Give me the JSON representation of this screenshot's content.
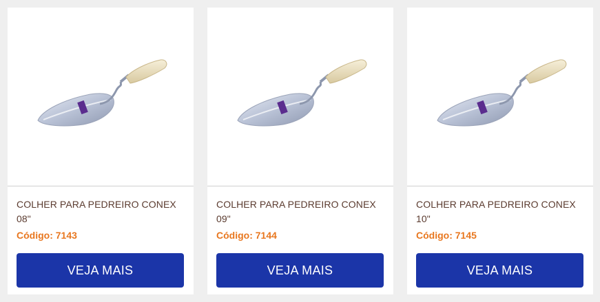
{
  "products": [
    {
      "title_line1": "COLHER PARA PEDREIRO CONEX",
      "title_line2": "08\"",
      "code": "Código: 7143",
      "button_label": "VEJA MAIS",
      "image_icon": "trowel-icon"
    },
    {
      "title_line1": "COLHER PARA PEDREIRO CONEX",
      "title_line2": "09\"",
      "code": "Código: 7144",
      "button_label": "VEJA MAIS",
      "image_icon": "trowel-icon"
    },
    {
      "title_line1": "COLHER PARA PEDREIRO CONEX",
      "title_line2": "10\"",
      "code": "Código: 7145",
      "button_label": "VEJA MAIS",
      "image_icon": "trowel-icon"
    }
  ],
  "colors": {
    "page_background": "#efefef",
    "title_text": "#5a3a2e",
    "code_text": "#e8771f",
    "button_background": "#1b35a8",
    "button_text": "#ffffff"
  }
}
